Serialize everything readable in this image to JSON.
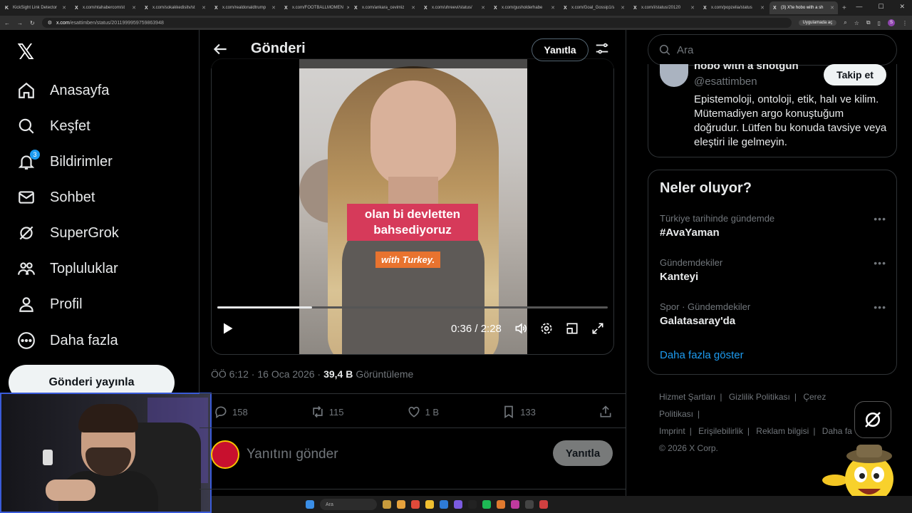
{
  "browser": {
    "tabs": [
      {
        "label": "KickSight Link Detector"
      },
      {
        "label": "x.com/ntahabercom/st"
      },
      {
        "label": "x.com/sokakkedisitv/st"
      },
      {
        "label": "x.com/realdonaldtrump"
      },
      {
        "label": "x.com/FOOTBALLMOMEN"
      },
      {
        "label": "x.com/ankara_cevimiz"
      },
      {
        "label": "x.com/uhreevi/status/"
      },
      {
        "label": "x.com/gusholderhabe"
      },
      {
        "label": "x.com/Goal_Gossip1/s"
      },
      {
        "label": "x.com/i/status/20120"
      },
      {
        "label": "x.com/popzelia/status"
      },
      {
        "label": "(3) X'te hobo with a sh"
      }
    ],
    "url_host": "x.com",
    "url_path": "/esattimben/status/2011999959759863948",
    "app_pill": "Uygulamada aç",
    "profile_initial": "S"
  },
  "nav": {
    "items": [
      {
        "label": "Anasayfa",
        "icon": "home-icon"
      },
      {
        "label": "Keşfet",
        "icon": "search-icon"
      },
      {
        "label": "Bildirimler",
        "icon": "bell-icon",
        "badge": "3"
      },
      {
        "label": "Sohbet",
        "icon": "mail-icon"
      },
      {
        "label": "SuperGrok",
        "icon": "grok-icon"
      },
      {
        "label": "Topluluklar",
        "icon": "communities-icon"
      },
      {
        "label": "Profil",
        "icon": "profile-icon"
      },
      {
        "label": "Daha fazla",
        "icon": "more-circle-icon"
      }
    ],
    "post_button": "Gönderi yayınla"
  },
  "header": {
    "title": "Gönderi",
    "reply_button": "Yanıtla"
  },
  "video": {
    "caption_line1": "olan bi devletten bahsediyoruz",
    "caption_line2": "with Turkey.",
    "time": "0:36 / 2:28",
    "progress": 0.243
  },
  "post": {
    "time": "ÖÖ 6:12 · 16 Oca 2026 ·",
    "views": "39,4 B",
    "views_label": "Görüntüleme",
    "replies": "158",
    "reposts": "115",
    "likes": "1 B",
    "bookmarks": "133"
  },
  "reply": {
    "placeholder": "Yanıtını gönder",
    "button": "Yanıtla"
  },
  "right": {
    "search_placeholder": "Ara",
    "profile": {
      "name": "hobo with a shotgun",
      "handle": "@esattimben",
      "follow": "Takip et",
      "bio": "Epistemoloji, ontoloji, etik, halı ve kilim. Mütemadiyen argo konuştuğum doğrudur. Lütfen bu konuda tavsiye veya eleştiri ile gelmeyin."
    },
    "trends_title": "Neler oluyor?",
    "trends": [
      {
        "context": "Türkiye tarihinde gündemde",
        "name": "#AvaYaman"
      },
      {
        "context": "Gündemdekiler",
        "name": "Kanteyi"
      },
      {
        "context": "Spor · Gündemdekiler",
        "name": "Galatasaray'da"
      }
    ],
    "show_more": "Daha fazla göster",
    "footer_links": [
      "Hizmet Şartları",
      "|",
      "Gizlilik Politikası",
      "|",
      "Çerez Politikası",
      "|",
      "Imprint",
      "|",
      "Erişilebilirlik",
      "|",
      "Reklam bilgisi",
      "|",
      "Daha fa"
    ],
    "copyright": "© 2026 X Corp."
  },
  "taskbar": {
    "search": "Ara"
  }
}
